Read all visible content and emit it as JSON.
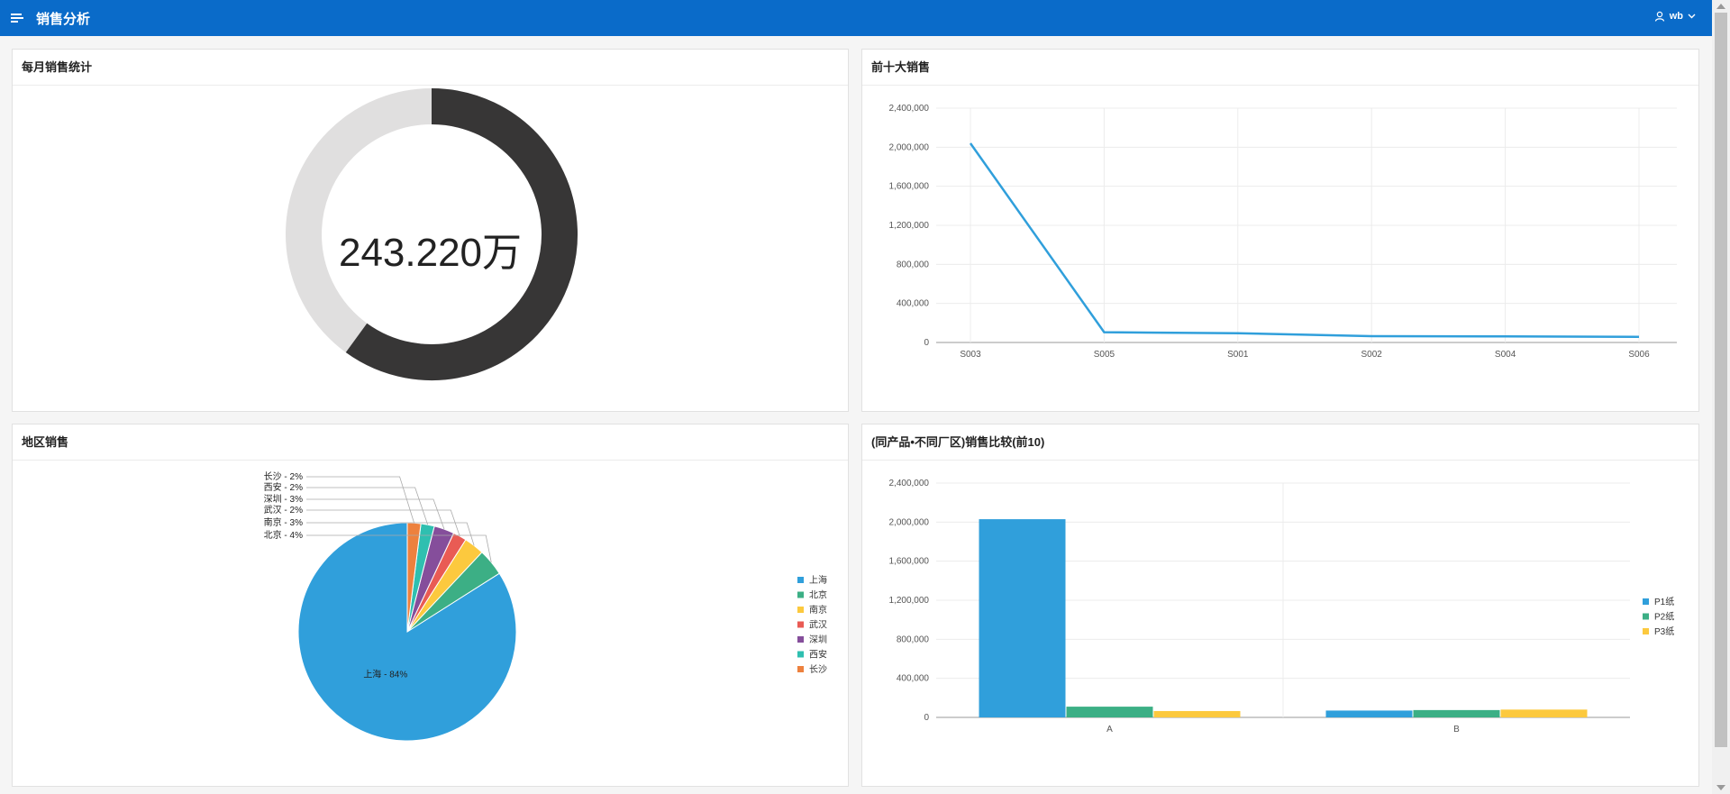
{
  "header": {
    "title": "销售分析",
    "user": "wb"
  },
  "cards": {
    "monthly": {
      "title": "每月销售统计",
      "value": "243.220万"
    },
    "top10": {
      "title": "前十大销售"
    },
    "region": {
      "title": "地区销售"
    },
    "compare": {
      "title": "(同产品•不同厂区)销售比较(前10)"
    }
  },
  "colors": {
    "header": "#0a6bc9",
    "donut_fill": "#373636",
    "donut_track": "#e0dfdf",
    "line": "#309fdb"
  },
  "monthly_gauge": {
    "fraction": 0.6
  },
  "chart_data": [
    {
      "type": "line",
      "categories": [
        "S003",
        "S005",
        "S001",
        "S002",
        "S004",
        "S006"
      ],
      "values": [
        2040000,
        105000,
        95000,
        65000,
        62000,
        58000
      ],
      "ylim": [
        0,
        2400000
      ],
      "yticks": [
        "0",
        "400,000",
        "800,000",
        "1,200,000",
        "1,600,000",
        "2,000,000",
        "2,400,000"
      ],
      "grid": true
    },
    {
      "type": "pie",
      "slices": [
        {
          "name": "上海",
          "value": 84,
          "label": "上海 - 84%",
          "color": "#309fdb"
        },
        {
          "name": "北京",
          "value": 4,
          "label": "北京 - 4%",
          "color": "#3caf85"
        },
        {
          "name": "南京",
          "value": 3,
          "label": "南京 - 3%",
          "color": "#fcc93e"
        },
        {
          "name": "武汉",
          "value": 2,
          "label": "武汉 - 2%",
          "color": "#e95b54"
        },
        {
          "name": "深圳",
          "value": 3,
          "label": "深圳 - 3%",
          "color": "#854e9b"
        },
        {
          "name": "西安",
          "value": 2,
          "label": "西安 - 2%",
          "color": "#2fbfb0"
        },
        {
          "name": "长沙",
          "value": 2,
          "label": "长沙 - 2%",
          "color": "#ed813e"
        }
      ],
      "legend": "right"
    },
    {
      "type": "bar",
      "categories": [
        "A",
        "B"
      ],
      "series": [
        {
          "name": "P1纸",
          "values": [
            2030000,
            70000
          ],
          "color": "#309fdb"
        },
        {
          "name": "P2纸",
          "values": [
            110000,
            75000
          ],
          "color": "#3caf85"
        },
        {
          "name": "P3纸",
          "values": [
            65000,
            80000
          ],
          "color": "#fcc93e"
        }
      ],
      "ylim": [
        0,
        2400000
      ],
      "yticks": [
        "0",
        "400,000",
        "800,000",
        "1,200,000",
        "1,600,000",
        "2,000,000",
        "2,400,000"
      ],
      "legend": "right"
    }
  ]
}
